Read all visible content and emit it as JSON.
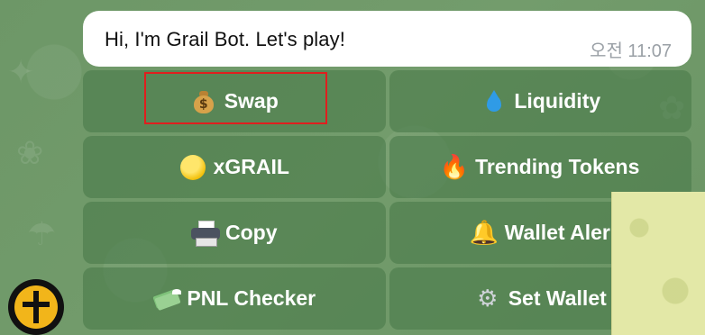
{
  "message": {
    "text": "Hi, I'm Grail Bot. Let's play!",
    "time": "오전 11:07"
  },
  "keyboard": {
    "rows": [
      [
        {
          "label": "Swap",
          "icon": "money-bag-icon"
        },
        {
          "label": "Liquidity",
          "icon": "droplet-icon"
        }
      ],
      [
        {
          "label": "xGRAIL",
          "icon": "yellow-circle-icon"
        },
        {
          "label": "Trending Tokens",
          "icon": "fire-icon"
        }
      ],
      [
        {
          "label": "Copy",
          "icon": "printer-icon"
        },
        {
          "label": "Wallet Aler",
          "icon": "bell-icon"
        }
      ],
      [
        {
          "label": "PNL Checker",
          "icon": "money-wings-icon"
        },
        {
          "label": "Set Wallet",
          "icon": "gear-icon"
        }
      ]
    ]
  },
  "colors": {
    "chat_background": "#6f9a6a",
    "button_background": "#4a7a4a",
    "highlight": "#e01e1e",
    "bubble": "#ffffff",
    "time_text": "#9aa0a6"
  },
  "highlighted_button": "Swap"
}
